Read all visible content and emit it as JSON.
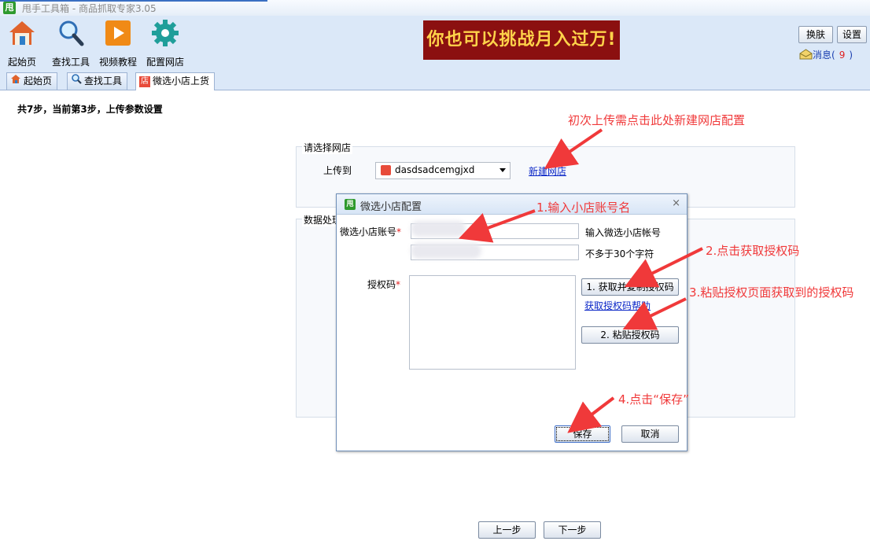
{
  "window": {
    "logo_char": "甩",
    "title": "甩手工具箱 - 商品抓取专家3.05"
  },
  "toolbar": {
    "items": [
      {
        "label": "起始页",
        "icon": "home-icon"
      },
      {
        "label": "查找工具",
        "icon": "magnifier-icon"
      },
      {
        "label": "视频教程",
        "icon": "play-video-icon"
      },
      {
        "label": "配置网店",
        "icon": "gear-icon"
      }
    ],
    "banner": "你也可以挑战月入过万!",
    "skin_button": "换肤",
    "settings_button": "设置",
    "messages": {
      "label": "消息(",
      "count": "9",
      "suffix": ")"
    }
  },
  "tabs": [
    {
      "label": "起始页",
      "icon": "home-icon"
    },
    {
      "label": "查找工具",
      "icon": "magnifier-icon"
    },
    {
      "label": "微选小店上货",
      "icon": "shop-icon",
      "active": true
    }
  ],
  "page": {
    "step_text": "共7步，当前第3步，上传参数设置",
    "shop_group_label": "请选择网店",
    "upload_to_label": "上传到",
    "selected_shop": "dasdsadcemgjxd",
    "new_shop_link": "新建网店",
    "data_group_label": "数据处理",
    "prev_button": "上一步",
    "next_button": "下一步"
  },
  "dialog": {
    "logo_char": "甩",
    "title": "微选小店配置",
    "close": "×",
    "account_label": "微选小店账号",
    "required_mark": "*",
    "account_hint": "输入微选小店帐号",
    "second_hint": "不多于30个字符",
    "auth_label": "授权码",
    "get_auth_button": "1. 获取并复制授权码",
    "auth_help_link": "获取授权码帮助",
    "paste_button": "2. 粘贴授权码",
    "save_button": "保存",
    "cancel_button": "取消"
  },
  "annotations": {
    "new_shop": "初次上传需点击此处新建网店配置",
    "step1": "1.输入小店账号名",
    "step2": "2.点击获取授权码",
    "step3": "3.粘贴授权页面获取到的授权码",
    "step4": "4.点击“保存”"
  },
  "colors": {
    "annotation": "#f0393a",
    "banner_bg": "#8b1010",
    "banner_text": "#ffd34a",
    "link": "#0b27c7"
  }
}
